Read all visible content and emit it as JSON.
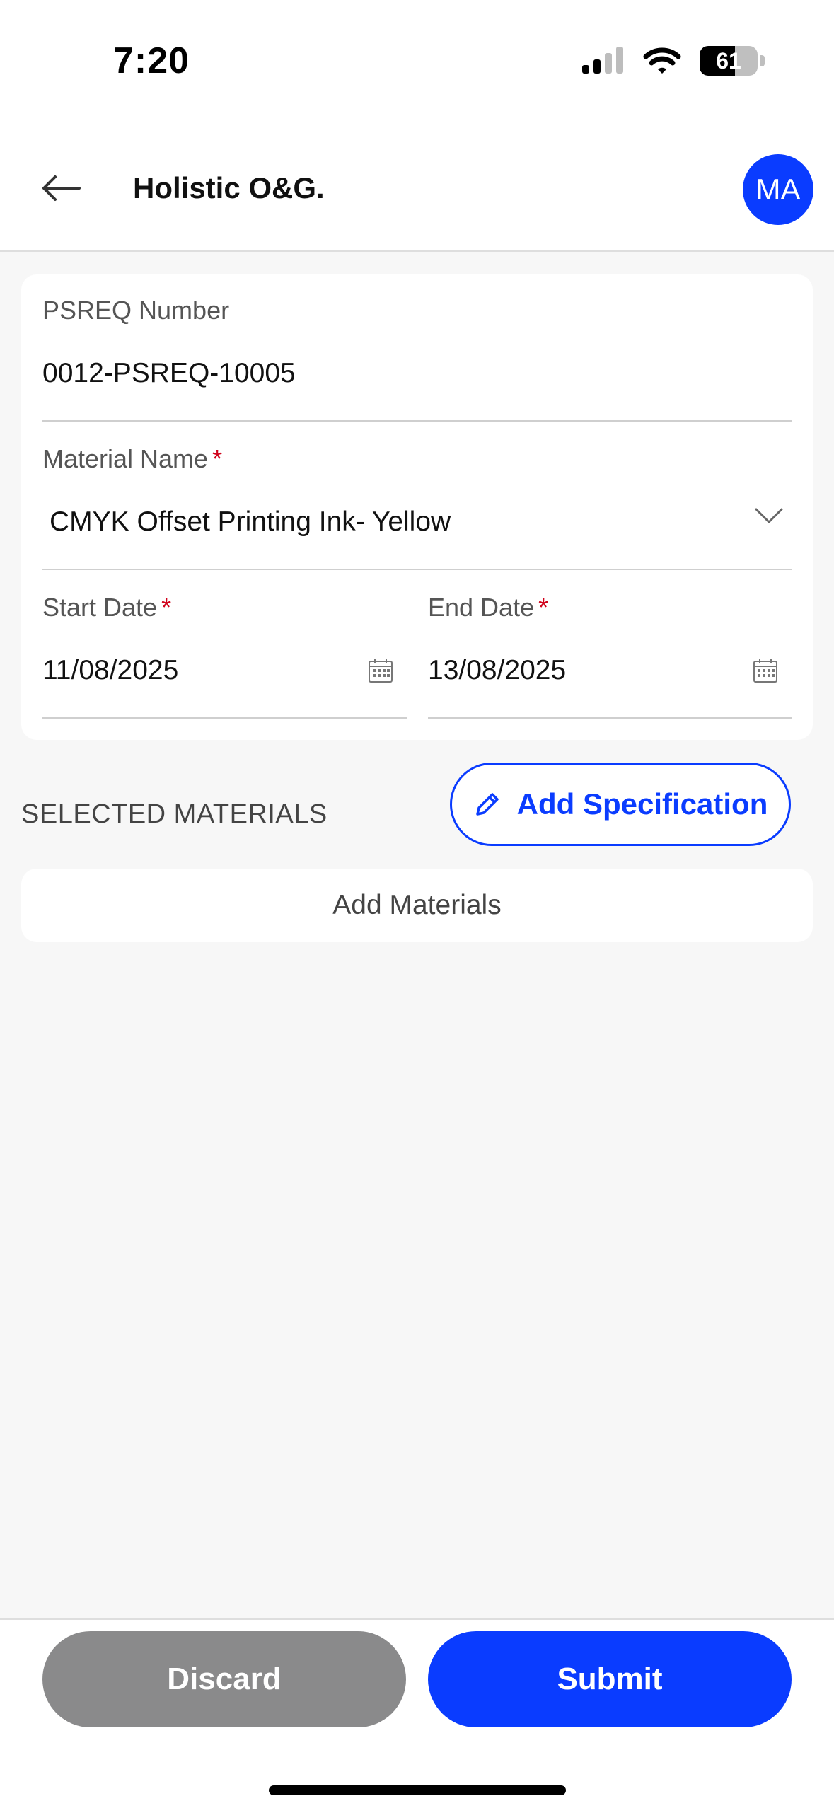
{
  "status_bar": {
    "time": "7:20",
    "battery": "61",
    "battery_level": 0.61
  },
  "header": {
    "title": "Holistic O&G.",
    "avatar_initials": "MA"
  },
  "form": {
    "psreq_label": "PSREQ Number",
    "psreq_value": "0012-PSREQ-10005",
    "material_label": "Material Name",
    "material_value": "CMYK Offset Printing Ink- Yellow",
    "start_label": "Start Date",
    "start_value": "11/08/2025",
    "end_label": "End Date",
    "end_value": "13/08/2025",
    "required_mark": "*"
  },
  "materials": {
    "section_title": "SELECTED MATERIALS",
    "add_spec_label": "Add Specification",
    "add_materials_label": "Add Materials"
  },
  "actions": {
    "discard_label": "Discard",
    "submit_label": "Submit"
  },
  "colors": {
    "accent": "#0a3cff",
    "required": "#d0021b",
    "discard": "#8a8a8b"
  }
}
